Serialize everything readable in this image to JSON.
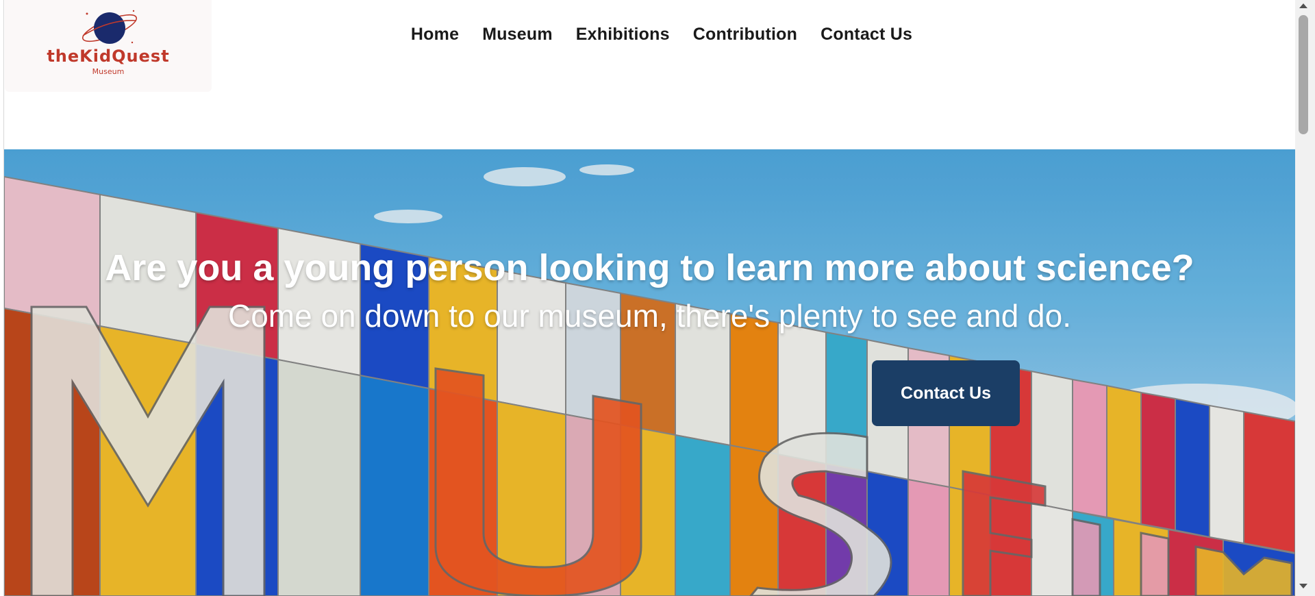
{
  "brand": {
    "name": "theKidQuest",
    "subtitle": "Museum",
    "logo_icon": "planet-icon",
    "color": "#c0392b"
  },
  "nav": {
    "items": [
      {
        "label": "Home"
      },
      {
        "label": "Museum"
      },
      {
        "label": "Exhibitions"
      },
      {
        "label": "Contribution"
      },
      {
        "label": "Contact Us"
      }
    ]
  },
  "hero": {
    "title": "Are you a young person looking to learn more about science?",
    "subtitle": "Come on down to our museum, there's plenty to see and do.",
    "cta_label": "Contact Us",
    "cta_color": "#1b3e66",
    "background_image": "colorful museum facade with large MUSEUM letters against blue sky"
  }
}
